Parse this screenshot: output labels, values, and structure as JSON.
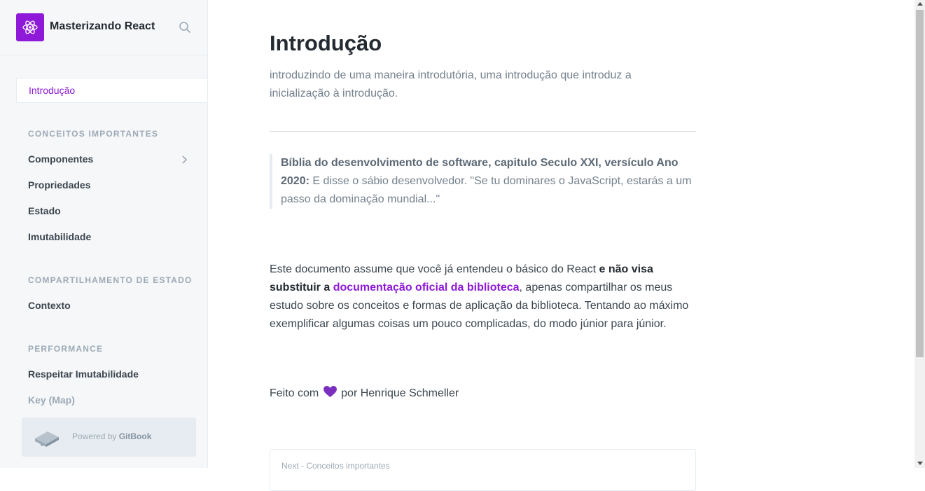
{
  "brand": {
    "title": "Masterizando React"
  },
  "sidebar": {
    "active_item": "Introdução",
    "sections": [
      {
        "title": "CONCEITOS IMPORTANTES",
        "items": [
          "Componentes",
          "Propriedades",
          "Estado",
          "Imutabilidade"
        ]
      },
      {
        "title": "COMPARTILHAMENTO DE ESTADO",
        "items": [
          "Contexto"
        ]
      },
      {
        "title": "PERFORMANCE",
        "items": [
          "Respeitar Imutabilidade",
          "Key (Map)"
        ]
      }
    ],
    "powered_prefix": "Powered by",
    "powered_brand": "GitBook"
  },
  "page": {
    "title": "Introdução",
    "description": "introduzindo de uma maneira introdutória, uma introdução que introduz a inicialização à introdução.",
    "quote_bold": "Bíblia do desenvolvimento de software, capitulo Seculo XXI, versículo Ano 2020:",
    "quote_text": " E disse o sábio desenvolvedor. \"Se tu dominares o JavaScript, estarás a um passo da dominação mundial...\"",
    "para_start": "Este documento assume que você já entendeu o básico do React ",
    "para_bold": "e não visa substituir a ",
    "para_link": "documentação oficial da biblioteca",
    "para_end": ", apenas compartilhar os meus estudo sobre os conceitos e formas de aplicação da biblioteca. Tentando ao máximo exemplificar algumas coisas um pouco complicadas, do modo júnior para júnior.",
    "footer_prefix": "Feito com",
    "footer_suffix": "por Henrique Schmeller",
    "next_label": "Next - Conceitos importantes"
  },
  "colors": {
    "accent": "#8e19d8",
    "sidebar_bg": "#f5f7f9",
    "heart": "#7b2fbe"
  },
  "icons": [
    "react-logo-icon",
    "search-icon",
    "chevron-right-icon",
    "gitbook-icon",
    "purple-heart-icon"
  ]
}
